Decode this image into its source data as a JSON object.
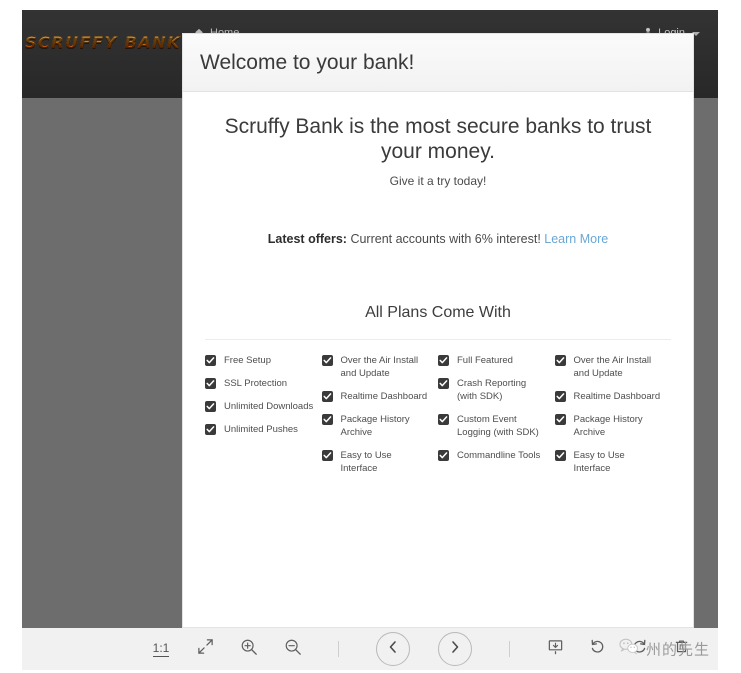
{
  "site": {
    "brand": "SCRUFFY BANK",
    "nav": {
      "home_label": "Home",
      "login_label": "Login"
    }
  },
  "card": {
    "header_title": "Welcome to your bank!",
    "jumbotron": {
      "headline": "Scruffy Bank is the most secure banks to trust your money.",
      "subline": "Give it a try today!"
    },
    "offers": {
      "label": "Latest offers:",
      "text": " Current accounts with 6% interest! ",
      "link_label": "Learn More"
    },
    "plans": {
      "title": "All Plans Come With",
      "columns": [
        {
          "items": [
            "Free Setup",
            "SSL Protection",
            "Unlimited Downloads",
            "Unlimited Pushes"
          ]
        },
        {
          "items": [
            "Over the Air Install and Update",
            "Realtime Dashboard",
            "Package History Archive",
            "Easy to Use Interface"
          ]
        },
        {
          "items": [
            "Full Featured",
            "Crash Reporting (with SDK)",
            "Custom Event Logging (with SDK)",
            "Commandline Tools"
          ]
        },
        {
          "items": [
            "Over the Air Install and Update",
            "Realtime Dashboard",
            "Package History Archive",
            "Easy to Use Interface"
          ]
        }
      ]
    }
  },
  "toolbar": {
    "actual_size_label": "1:1",
    "fit_label": "Fit to screen",
    "zoom_in_label": "Zoom in",
    "zoom_out_label": "Zoom out",
    "back_label": "Back",
    "forward_label": "Forward",
    "capture_label": "Capture",
    "rotate_left_label": "Rotate left",
    "rotate_right_label": "Rotate right",
    "delete_label": "Delete"
  },
  "watermark": {
    "text": "州的先生"
  },
  "colors": {
    "navbar_bg": "#2e2e2e",
    "page_bg": "#6d6d6d",
    "brand_orange": "#ff9c1a",
    "link_blue": "#6aa7d4",
    "toolbar_bg": "#f1f1f1"
  }
}
